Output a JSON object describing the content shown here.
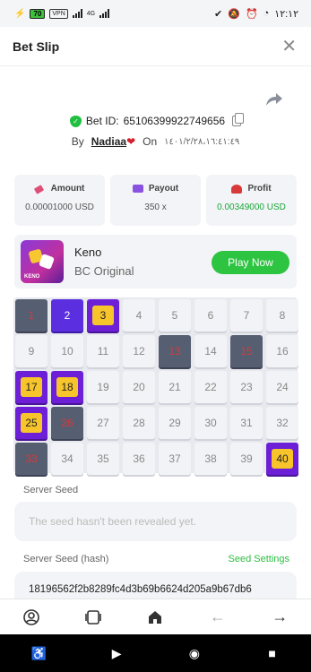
{
  "status_bar": {
    "battery": "70",
    "vpn": "VPN",
    "network": "4G",
    "time": "١٢:١٢"
  },
  "header": {
    "title": "Bet Slip"
  },
  "bet": {
    "id_label": "Bet ID:",
    "id_value": "65106399922749656",
    "by_label": "By",
    "user": "Nadiaa",
    "on_label": "On",
    "date": "١٤٠١/٢/٢٨،١٦:٤١:٤٩"
  },
  "stats": [
    {
      "label": "Amount",
      "value": "0.00001000 USD"
    },
    {
      "label": "Payout",
      "value": "350 x"
    },
    {
      "label": "Profit",
      "value": "0.00349000 USD"
    }
  ],
  "game": {
    "name": "Keno",
    "subtitle": "BC Original",
    "thumb_label": "KENO",
    "play_label": "Play Now"
  },
  "board": {
    "tiles": [
      {
        "n": "1",
        "s": "miss"
      },
      {
        "n": "2",
        "s": "selected"
      },
      {
        "n": "3",
        "s": "hit"
      },
      {
        "n": "4",
        "s": ""
      },
      {
        "n": "5",
        "s": ""
      },
      {
        "n": "6",
        "s": ""
      },
      {
        "n": "7",
        "s": ""
      },
      {
        "n": "8",
        "s": ""
      },
      {
        "n": "9",
        "s": ""
      },
      {
        "n": "10",
        "s": ""
      },
      {
        "n": "11",
        "s": ""
      },
      {
        "n": "12",
        "s": ""
      },
      {
        "n": "13",
        "s": "miss"
      },
      {
        "n": "14",
        "s": ""
      },
      {
        "n": "15",
        "s": "miss"
      },
      {
        "n": "16",
        "s": ""
      },
      {
        "n": "17",
        "s": "hit"
      },
      {
        "n": "18",
        "s": "hit"
      },
      {
        "n": "19",
        "s": ""
      },
      {
        "n": "20",
        "s": ""
      },
      {
        "n": "21",
        "s": ""
      },
      {
        "n": "22",
        "s": ""
      },
      {
        "n": "23",
        "s": ""
      },
      {
        "n": "24",
        "s": ""
      },
      {
        "n": "25",
        "s": "hit"
      },
      {
        "n": "26",
        "s": "miss"
      },
      {
        "n": "27",
        "s": ""
      },
      {
        "n": "28",
        "s": ""
      },
      {
        "n": "29",
        "s": ""
      },
      {
        "n": "30",
        "s": ""
      },
      {
        "n": "31",
        "s": ""
      },
      {
        "n": "32",
        "s": ""
      },
      {
        "n": "33",
        "s": "miss"
      },
      {
        "n": "34",
        "s": ""
      },
      {
        "n": "35",
        "s": ""
      },
      {
        "n": "36",
        "s": ""
      },
      {
        "n": "37",
        "s": ""
      },
      {
        "n": "38",
        "s": ""
      },
      {
        "n": "39",
        "s": ""
      },
      {
        "n": "40",
        "s": "hit"
      }
    ]
  },
  "server_seed": {
    "label": "Server Seed",
    "placeholder": "The seed hasn't been revealed yet."
  },
  "server_seed_hash": {
    "label": "Server Seed (hash)",
    "settings_label": "Seed Settings",
    "value": "18196562f2b8289fc4d3b69b6624d205a9b67db6"
  },
  "colors": {
    "accent_green": "#2cc440",
    "hit_purple": "#6c1fd6",
    "hit_gold": "#f7c52b",
    "miss_gray": "#565e72"
  }
}
